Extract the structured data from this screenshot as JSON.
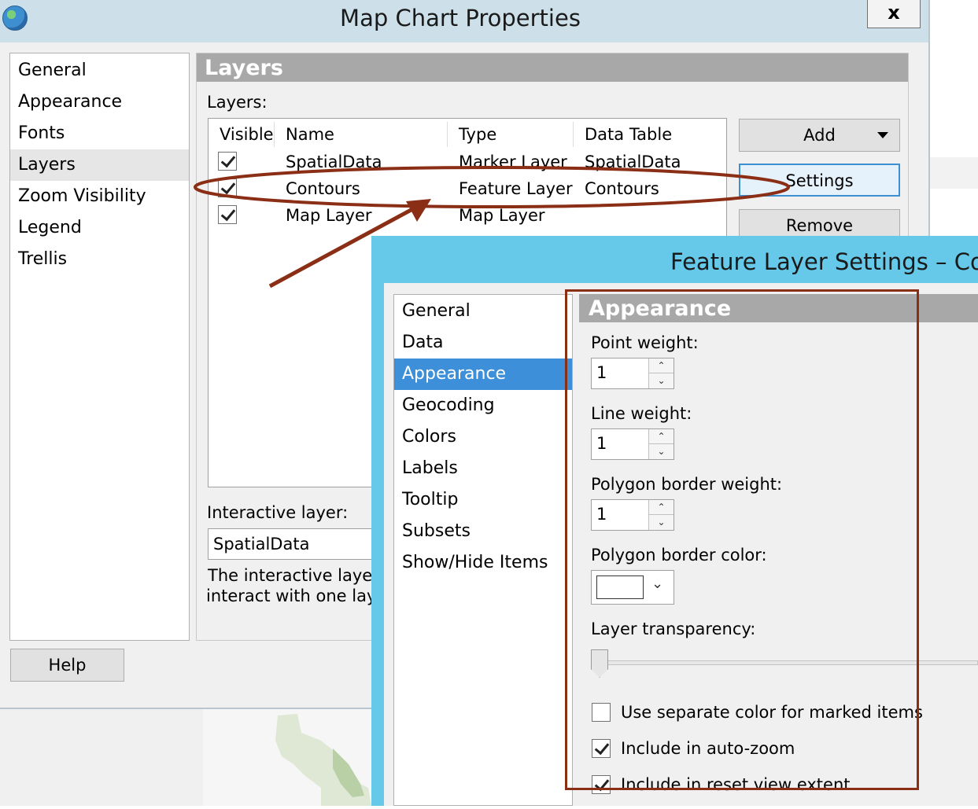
{
  "main_dialog": {
    "title": "Map Chart Properties",
    "close_label": "x",
    "nav_items": [
      "General",
      "Appearance",
      "Fonts",
      "Layers",
      "Zoom Visibility",
      "Legend",
      "Trellis"
    ],
    "selected_nav": "Layers",
    "help_label": "Help",
    "layers": {
      "header": "Layers",
      "layers_label": "Layers:",
      "columns": [
        "Visible",
        "Name",
        "Type",
        "Data Table"
      ],
      "rows": [
        {
          "visible": true,
          "name": "SpatialData",
          "type": "Marker Layer",
          "data_table": "SpatialData"
        },
        {
          "visible": true,
          "name": "Contours",
          "type": "Feature Layer",
          "data_table": "Contours"
        },
        {
          "visible": true,
          "name": "Map Layer",
          "type": "Map Layer",
          "data_table": ""
        }
      ],
      "buttons": {
        "add": "Add",
        "settings": "Settings",
        "remove": "Remove"
      },
      "interactive_label": "Interactive layer:",
      "interactive_value": "SpatialData",
      "description_line1": "The interactive layer d",
      "description_line2": "interact with one layer"
    }
  },
  "feature_dialog": {
    "title": "Feature Layer Settings – Conto",
    "nav_items": [
      "General",
      "Data",
      "Appearance",
      "Geocoding",
      "Colors",
      "Labels",
      "Tooltip",
      "Subsets",
      "Show/Hide Items"
    ],
    "selected_nav": "Appearance",
    "appearance": {
      "header": "Appearance",
      "point_weight_label": "Point weight:",
      "point_weight": "1",
      "line_weight_label": "Line weight:",
      "line_weight": "1",
      "polygon_border_weight_label": "Polygon border weight:",
      "polygon_border_weight": "1",
      "polygon_border_color_label": "Polygon border color:",
      "polygon_border_color": "#ffffff",
      "layer_transparency_label": "Layer transparency:",
      "layer_transparency": 0,
      "checkboxes": [
        {
          "label": "Use separate color for marked items",
          "checked": false
        },
        {
          "label": "Include in auto-zoom",
          "checked": true
        },
        {
          "label": "Include in reset view extent",
          "checked": true
        }
      ]
    }
  },
  "colors": {
    "annotation": "#8b2e16",
    "selection_blue": "#3c8fd8",
    "dialog_cyan": "#66c9ea"
  }
}
